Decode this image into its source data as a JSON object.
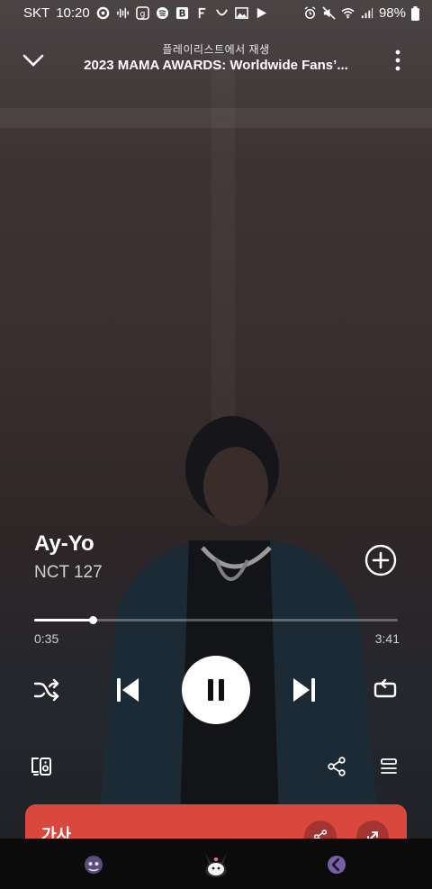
{
  "status_bar": {
    "carrier": "SKT",
    "time": "10:20",
    "battery": "98%",
    "left_icons": [
      "record-icon",
      "audio-wave-icon",
      "g-app-icon",
      "spotify-icon",
      "b-app-icon",
      "f-app-icon",
      "smile-icon",
      "image-icon",
      "play-store-icon"
    ],
    "right_icons": [
      "alarm-icon",
      "mute-icon",
      "wifi-icon",
      "signal-icon",
      "battery-icon"
    ]
  },
  "header": {
    "subtitle": "플레이리스트에서 재생",
    "title": "2023 MAMA AWARDS: Worldwide Fans’..."
  },
  "track": {
    "title": "Ay-Yo",
    "artist": "NCT 127"
  },
  "progress": {
    "elapsed": "0:35",
    "duration": "3:41",
    "fraction": 0.16
  },
  "lyrics": {
    "label": "가사"
  },
  "colors": {
    "accent_lyrics": "#d9473f",
    "text_primary": "#ffffff",
    "text_secondary": "#cfcfcf"
  }
}
